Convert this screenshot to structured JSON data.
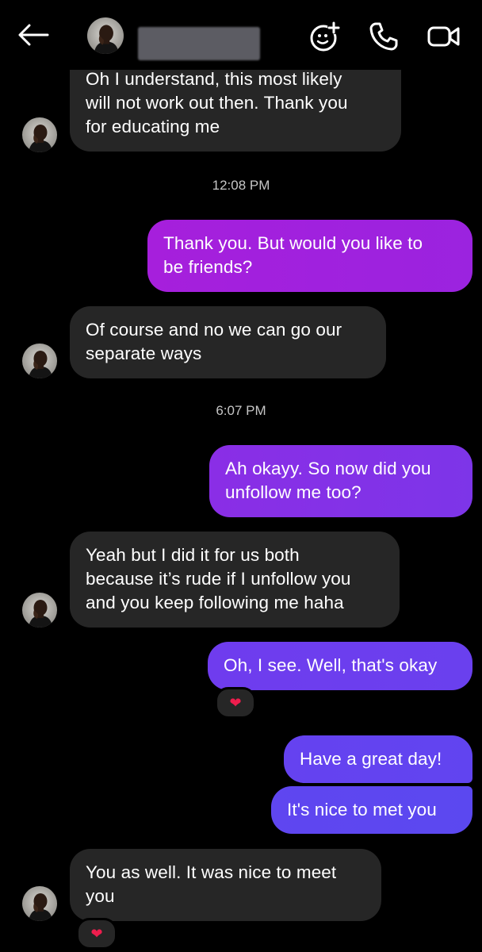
{
  "header": {
    "contact_name_redacted": true,
    "icons": [
      "back-arrow-icon",
      "avatar",
      "effects-icon",
      "phone-icon",
      "video-camera-icon"
    ]
  },
  "colors": {
    "background": "#000000",
    "received_bubble": "#262626",
    "sent_bubble_top": "#a61fdc",
    "sent_bubble_bottom": "#5b48f0",
    "timestamp": "#c6c6c6",
    "reaction_heart": "#ee1d4d"
  },
  "messages": [
    {
      "id": "m1",
      "from": "them",
      "text": "Oh I understand, this most likely\nwill not work out then. Thank you\nfor educating me"
    },
    {
      "id": "t1",
      "type": "timestamp",
      "text": "12:08 PM"
    },
    {
      "id": "m2",
      "from": "me",
      "text": "Thank you. But would you like to\nbe friends?"
    },
    {
      "id": "m3",
      "from": "them",
      "text": "Of course and no we can go our\nseparate ways"
    },
    {
      "id": "t2",
      "type": "timestamp",
      "text": "6:07 PM"
    },
    {
      "id": "m4",
      "from": "me",
      "text": "Ah okayy. So now did you\nunfollow me too?"
    },
    {
      "id": "m5",
      "from": "them",
      "text": "Yeah but I did it for us both\nbecause it’s rude if I unfollow you\nand you keep following me haha"
    },
    {
      "id": "m6",
      "from": "me",
      "text": "Oh, I see. Well, that's okay",
      "reaction": "❤"
    },
    {
      "id": "m7",
      "from": "me",
      "text": "Have a great day!"
    },
    {
      "id": "m8",
      "from": "me",
      "text": "It's nice to met you"
    },
    {
      "id": "m9",
      "from": "them",
      "text": "You as well. It was nice to meet\nyou",
      "reaction": "❤"
    }
  ]
}
